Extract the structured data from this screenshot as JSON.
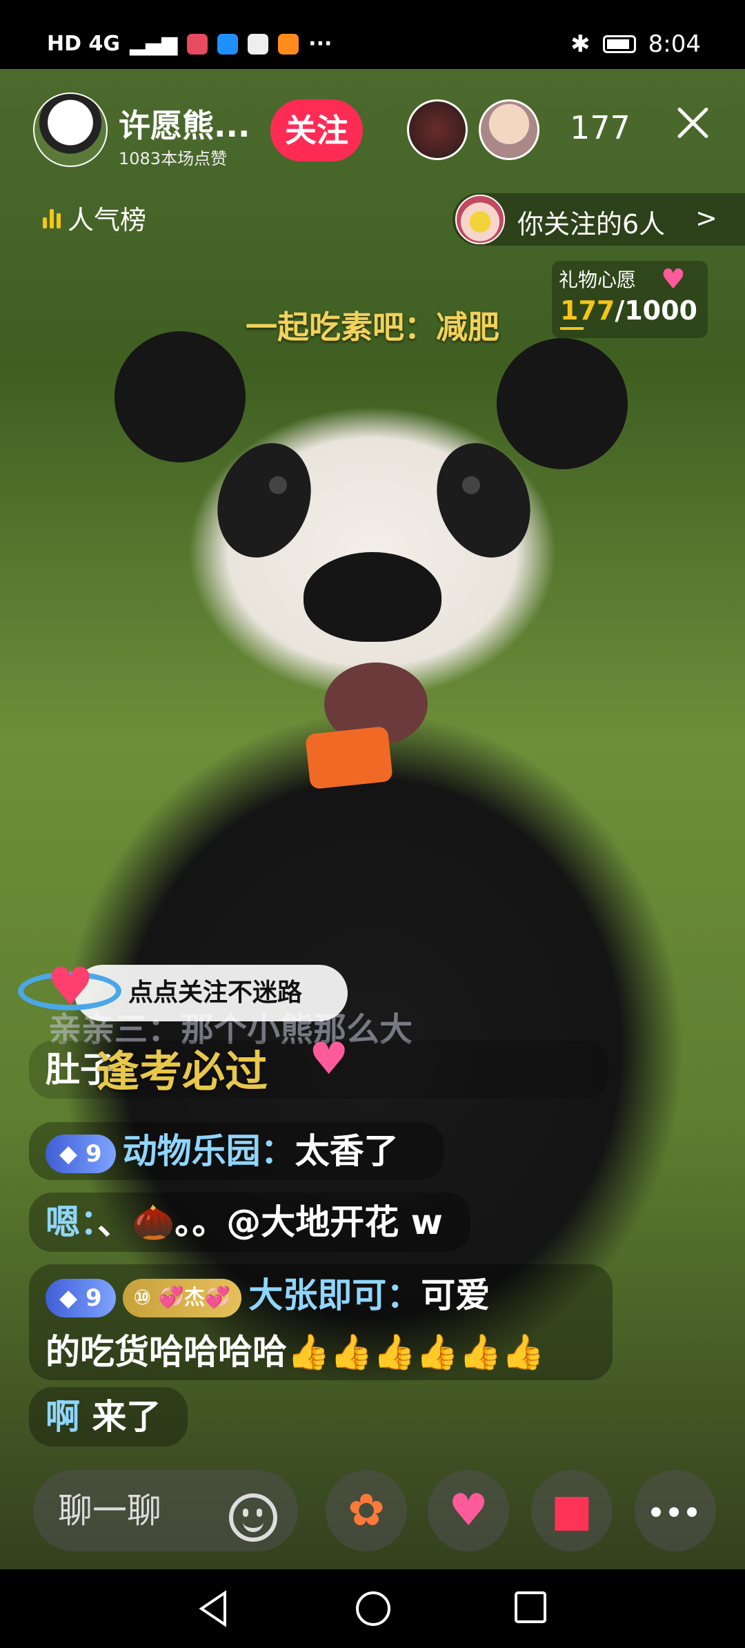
{
  "status_bar": {
    "network": "HD 4G",
    "time": "8:04",
    "more": "···"
  },
  "host": {
    "name": "许愿熊...",
    "likes": "1083本场点赞",
    "follow_label": "关注"
  },
  "viewer_count": "177",
  "rank_label": "人气榜",
  "followed_pill": {
    "text": "你关注的6人",
    "chevron": ">"
  },
  "gift_wish": {
    "title": "礼物心愿",
    "current": "177",
    "total": "/1000"
  },
  "caption": "一起吃素吧：减肥",
  "notice": "点点关注不迷路",
  "comments": [
    {
      "user": "亲亲三：",
      "text": "那个小熊那么大"
    },
    {
      "text": "肚子"
    },
    {
      "level": "9",
      "user": "动物乐园：",
      "text": "太香了"
    },
    {
      "user": "嗯：",
      "text": "、🌰。。@大地开花 w"
    },
    {
      "level": "9",
      "fan_level": "⑩",
      "fan_name": "💞杰💞",
      "user": "大张即可：",
      "text": "可爱"
    },
    {
      "text": "的吃货哈哈哈哈👍👍👍👍👍👍"
    },
    {
      "user": "啊",
      "text": "来了"
    }
  ],
  "overlay_text": "逢考必过",
  "bottom_bar": {
    "chat_placeholder": "聊一聊"
  },
  "colors": {
    "follow": "#fe2c55",
    "nick": "#8fd6ff",
    "gold": "#f5c518"
  }
}
